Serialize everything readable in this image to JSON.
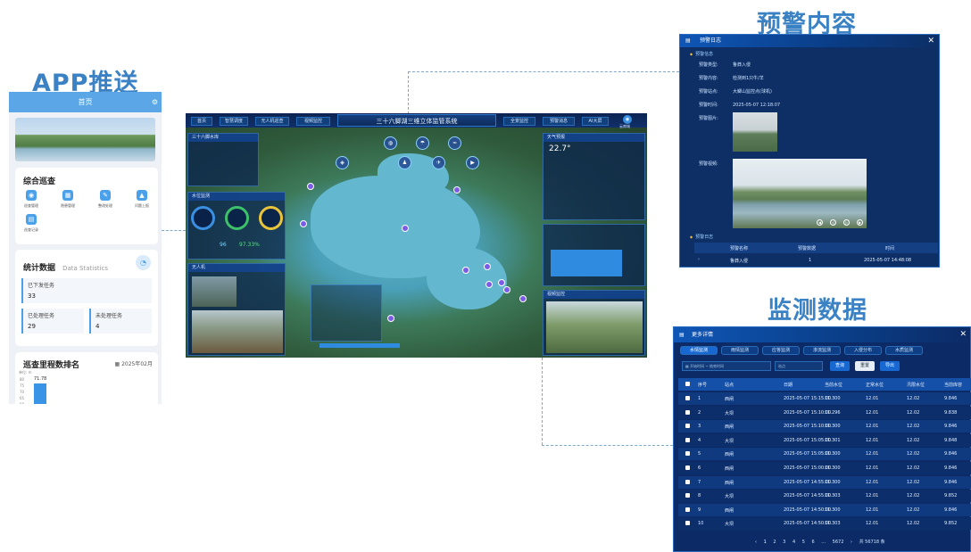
{
  "titles": {
    "app": "APP推送",
    "warning": "预警内容",
    "monitoring": "监测数据"
  },
  "app": {
    "header": "首页",
    "inspection_title": "综合巡查",
    "quick_items": [
      "巡查管理",
      "隐患管理",
      "整改处理",
      "问题上报",
      "巡查记录"
    ],
    "stats_title": "统计数据",
    "stats_subtitle": "Data Statistics",
    "stats": [
      {
        "label": "已下发任务",
        "value": "33"
      },
      {
        "label": "已处理任务",
        "value": "29"
      },
      {
        "label": "未处理任务",
        "value": "4"
      }
    ],
    "ranking_title": "巡查里程数排名",
    "ranking_date": "2025年02月",
    "ranking_unit": "单位: m",
    "ranking_ticks": [
      "80",
      "75",
      "70",
      "65",
      "60",
      "55"
    ],
    "ranking_value": "71.78"
  },
  "dashboard": {
    "title": "三十六脚湖三维立体监管系统",
    "nav": [
      "首页",
      "智慧调度",
      "无人机巡查",
      "视频监控",
      "全景监控",
      "预警消息",
      "AI大屏"
    ],
    "user": "云南城",
    "left_panel1": "三十六脚水库",
    "left_panel2": "水位监测",
    "gauges": [
      "",
      ""
    ],
    "percent": "97.33%",
    "count": "96",
    "drone_panel": "无人机",
    "right_panel_title": "天气预报",
    "temp": "22.7°",
    "bottom_panel": "视频监控",
    "hotspots": [
      "水位监测",
      "雨量监测",
      "流量监测",
      "水质监测",
      "人员入侵",
      "无人机",
      "视频监控"
    ]
  },
  "warning": {
    "header": "预警日志",
    "section_info": "预警信息",
    "rows": [
      {
        "k": "预警类型:",
        "v": "鲁莽入侵"
      },
      {
        "k": "预警内容:",
        "v": "检测到1只牛/羊"
      },
      {
        "k": "预警站点:",
        "v": "大鲫山监控点(球机)"
      },
      {
        "k": "预警时间:",
        "v": "2025-05-07 12:18:07"
      }
    ],
    "photo_label": "预警图片:",
    "video_label": "预警视频:",
    "section_log": "预警日志",
    "log_headers": [
      "预警名称",
      "预警数据",
      "时间"
    ],
    "log_row": [
      "鲁莽入侵",
      "1",
      "2025-05-07 14:48:08"
    ]
  },
  "monitoring": {
    "header": "更多详情",
    "tabs": [
      "水情监测",
      "雨情监测",
      "应答监测",
      "渗流监测",
      "入侵分布",
      "水质监测"
    ],
    "filter": {
      "start": "开始时间",
      "sep": "~",
      "end": "结束时间",
      "station": "站点",
      "query": "查询",
      "reset": "重置",
      "export": "导出"
    },
    "columns": [
      "序号",
      "站点",
      "日期",
      "当前水位",
      "正常水位",
      "汛限水位",
      "当前库容"
    ],
    "rows": [
      [
        "1",
        "西闸",
        "2025-05-07 15:15:00",
        "11.300",
        "12.01",
        "12.02",
        "9.846"
      ],
      [
        "2",
        "大坝",
        "2025-05-07 15:10:00",
        "11.296",
        "12.01",
        "12.02",
        "9.838"
      ],
      [
        "3",
        "西闸",
        "2025-05-07 15:10:00",
        "11.300",
        "12.01",
        "12.02",
        "9.846"
      ],
      [
        "4",
        "大坝",
        "2025-05-07 15:05:00",
        "11.301",
        "12.01",
        "12.02",
        "9.848"
      ],
      [
        "5",
        "西闸",
        "2025-05-07 15:05:00",
        "11.300",
        "12.01",
        "12.02",
        "9.846"
      ],
      [
        "6",
        "西闸",
        "2025-05-07 15:00:00",
        "11.300",
        "12.01",
        "12.02",
        "9.846"
      ],
      [
        "7",
        "西闸",
        "2025-05-07 14:55:00",
        "11.300",
        "12.01",
        "12.02",
        "9.846"
      ],
      [
        "8",
        "大坝",
        "2025-05-07 14:55:00",
        "11.303",
        "12.01",
        "12.02",
        "9.852"
      ],
      [
        "9",
        "西闸",
        "2025-05-07 14:50:00",
        "11.300",
        "12.01",
        "12.02",
        "9.846"
      ],
      [
        "10",
        "大坝",
        "2025-05-07 14:50:00",
        "11.303",
        "12.01",
        "12.02",
        "9.852"
      ]
    ],
    "pagination": [
      "1",
      "2",
      "3",
      "4",
      "5",
      "6",
      "...",
      "5672"
    ],
    "total": "共 56718 条"
  }
}
